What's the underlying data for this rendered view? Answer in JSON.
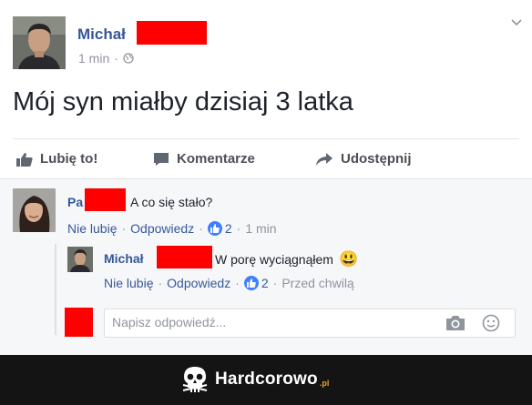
{
  "post": {
    "author": "Michał",
    "time": "1 min",
    "privacy_icon": "globe-icon",
    "text": "Mój syn miałby dzisiaj 3 latka"
  },
  "actions": {
    "like": "Lubię to!",
    "comment": "Komentarze",
    "share": "Udostępnij"
  },
  "comment1": {
    "author": "Pa",
    "text": "A co się stało?",
    "unlike": "Nie lubię",
    "reply": "Odpowiedz",
    "likes": "2",
    "time": "1 min"
  },
  "comment2": {
    "author": "Michał",
    "text": "W porę wyciągnąłem",
    "emoji": "😃",
    "unlike": "Nie lubię",
    "reply": "Odpowiedz",
    "likes": "2",
    "time": "Przed chwilą"
  },
  "reply_box": {
    "placeholder": "Napisz odpowiedź..."
  },
  "footer": {
    "brand": "Hardcorowo",
    "brand_suffix": ".pl"
  },
  "colors": {
    "link": "#365899",
    "meta": "#90949c",
    "redaction": "#ff0000",
    "footer_bg": "#141414",
    "brand_accent": "#f4a21d"
  }
}
